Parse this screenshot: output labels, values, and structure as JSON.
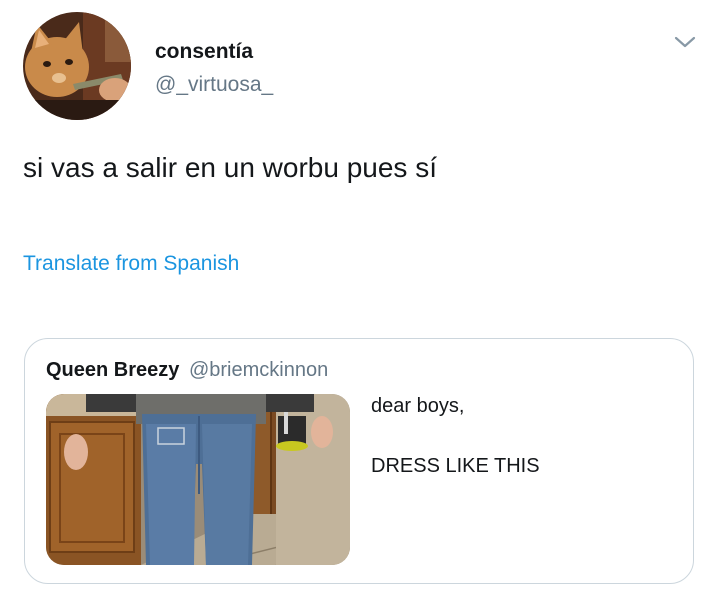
{
  "author": {
    "display_name": "consentía",
    "handle": "@_virtuosa_",
    "avatar_icon": "cat-avatar-icon"
  },
  "menu": {
    "icon": "chevron-down-icon"
  },
  "tweet": {
    "text": "si vas a salir en un worbu pues sí"
  },
  "translate": {
    "label": "Translate from Spanish",
    "color": "#1b95e0"
  },
  "quoted_tweet": {
    "author_name": "Queen Breezy",
    "author_handle": "@briemckinnon",
    "text_line1": "dear boys,",
    "text_line2": "DRESS LIKE THIS",
    "media_icon": "photo-thumbnail"
  },
  "colors": {
    "text_primary": "#14171a",
    "text_secondary": "#657786",
    "border": "#ccd6dd",
    "link": "#1b95e0"
  }
}
